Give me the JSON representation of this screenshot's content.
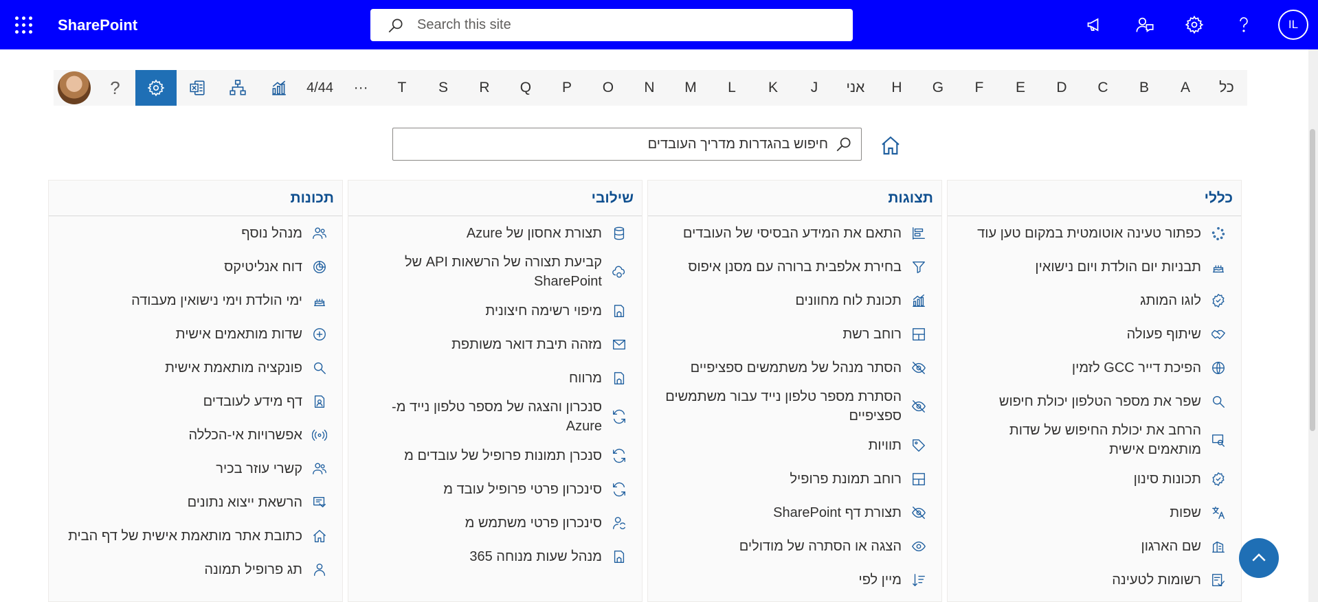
{
  "suitebar": {
    "brand": "SharePoint",
    "search_placeholder": "Search this site",
    "user_initials": "IL",
    "icons": [
      "megaphone-icon",
      "chat-person-icon",
      "gear-icon",
      "help-icon"
    ]
  },
  "alphabar": {
    "page_count": "4/44",
    "more": "···",
    "letters": [
      "T",
      "S",
      "R",
      "Q",
      "P",
      "O",
      "N",
      "M",
      "L",
      "K",
      "J",
      "אני",
      "H",
      "G",
      "F",
      "E",
      "D",
      "C",
      "B",
      "A",
      "כל"
    ],
    "help": "?"
  },
  "settings_search": {
    "placeholder": "חיפוש בהגדרות מדריך העובדים"
  },
  "columns": [
    {
      "title": "כללי",
      "items": [
        {
          "label": "כפתור טעינה אוטומטית במקום טען עוד",
          "icon": "spinner-icon"
        },
        {
          "label": "תבניות יום הולדת ויום נישואין",
          "icon": "cake-icon"
        },
        {
          "label": "לוגו המותג",
          "icon": "badge-icon"
        },
        {
          "label": "שיתוף פעולה",
          "icon": "handshake-icon"
        },
        {
          "label": "הפיכת דייר GCC לזמין",
          "icon": "globe-icon"
        },
        {
          "label": "שפר את מספר הטלפון יכולת חיפוש",
          "icon": "search-icon"
        },
        {
          "label": "הרחב את יכולת החיפוש של שדות מותאמים אישית",
          "icon": "search-window-icon"
        },
        {
          "label": "תכונות סינון",
          "icon": "badge-icon"
        },
        {
          "label": "שפות",
          "icon": "translate-icon"
        },
        {
          "label": "שם הארגון",
          "icon": "building-icon"
        },
        {
          "label": "רשומות לטעינה",
          "icon": "checklist-icon"
        }
      ]
    },
    {
      "title": "תצוגות",
      "items": [
        {
          "label": "התאם את המידע הבסיסי של העובדים",
          "icon": "align-icon"
        },
        {
          "label": "בחירת אלפבית ברורה עם מסנן איפוס",
          "icon": "filter-icon"
        },
        {
          "label": "תכונת לוח מחוונים",
          "icon": "chart-icon"
        },
        {
          "label": "רוחב רשת",
          "icon": "grid-icon"
        },
        {
          "label": "הסתר מנהל של משתמשים ספציפיים",
          "icon": "eye-off-icon"
        },
        {
          "label": "הסתרת מספר טלפון נייד עבור משתמשים ספציפיים",
          "icon": "eye-off-icon"
        },
        {
          "label": "תוויות",
          "icon": "tag-icon"
        },
        {
          "label": "רוחב תמונת פרופיל",
          "icon": "grid-icon"
        },
        {
          "label": "תצורת דף SharePoint",
          "icon": "eye-off-icon"
        },
        {
          "label": "הצגה או הסתרה של מודולים",
          "icon": "eye-icon"
        },
        {
          "label": "מיין לפי",
          "icon": "sort-icon"
        }
      ]
    },
    {
      "title": "שילובי",
      "items": [
        {
          "label": "תצורת אחסון של Azure",
          "icon": "database-icon"
        },
        {
          "label": "קביעת תצורה של הרשאות API של SharePoint",
          "icon": "cloud-sync-icon"
        },
        {
          "label": "מיפוי רשימה חיצונית",
          "icon": "map-doc-icon"
        },
        {
          "label": "מזהה תיבת דואר משותפת",
          "icon": "mail-icon"
        },
        {
          "label": "מרווח",
          "icon": "map-doc-icon"
        },
        {
          "label": "סנכרון והצגה של מספר טלפון נייד מ-Azure",
          "icon": "sync-icon"
        },
        {
          "label": "סנכרן תמונות פרופיל של עובדים מ",
          "icon": "sync-icon"
        },
        {
          "label": "סינכרון פרטי פרופיל עובד מ",
          "icon": "sync-icon"
        },
        {
          "label": "סינכרון פרטי משתמש מ",
          "icon": "person-sync-icon"
        },
        {
          "label": "מנהל שעות מנוחה 365",
          "icon": "map-doc-icon"
        }
      ]
    },
    {
      "title": "תכונות",
      "items": [
        {
          "label": "מנהל נוסף",
          "icon": "people-icon"
        },
        {
          "label": "דוח אנליטיקס",
          "icon": "analytics-icon"
        },
        {
          "label": "ימי הולדת וימי נישואין מעבודה",
          "icon": "cake-icon"
        },
        {
          "label": "שדות מותאמים אישית",
          "icon": "plus-circle-icon"
        },
        {
          "label": "פונקציה מותאמת אישית",
          "icon": "search-icon"
        },
        {
          "label": "דף מידע לעובדים",
          "icon": "doc-person-icon"
        },
        {
          "label": "אפשרויות אי-הכללה",
          "icon": "broadcast-icon"
        },
        {
          "label": "קשרי עוזר בכיר",
          "icon": "people-icon"
        },
        {
          "label": "הרשאת ייצוא נתונים",
          "icon": "export-icon"
        },
        {
          "label": "כתובת אתר מותאמת אישית של דף הבית",
          "icon": "home-icon"
        },
        {
          "label": "תג פרופיל תמונה",
          "icon": "person-icon"
        }
      ]
    }
  ]
}
